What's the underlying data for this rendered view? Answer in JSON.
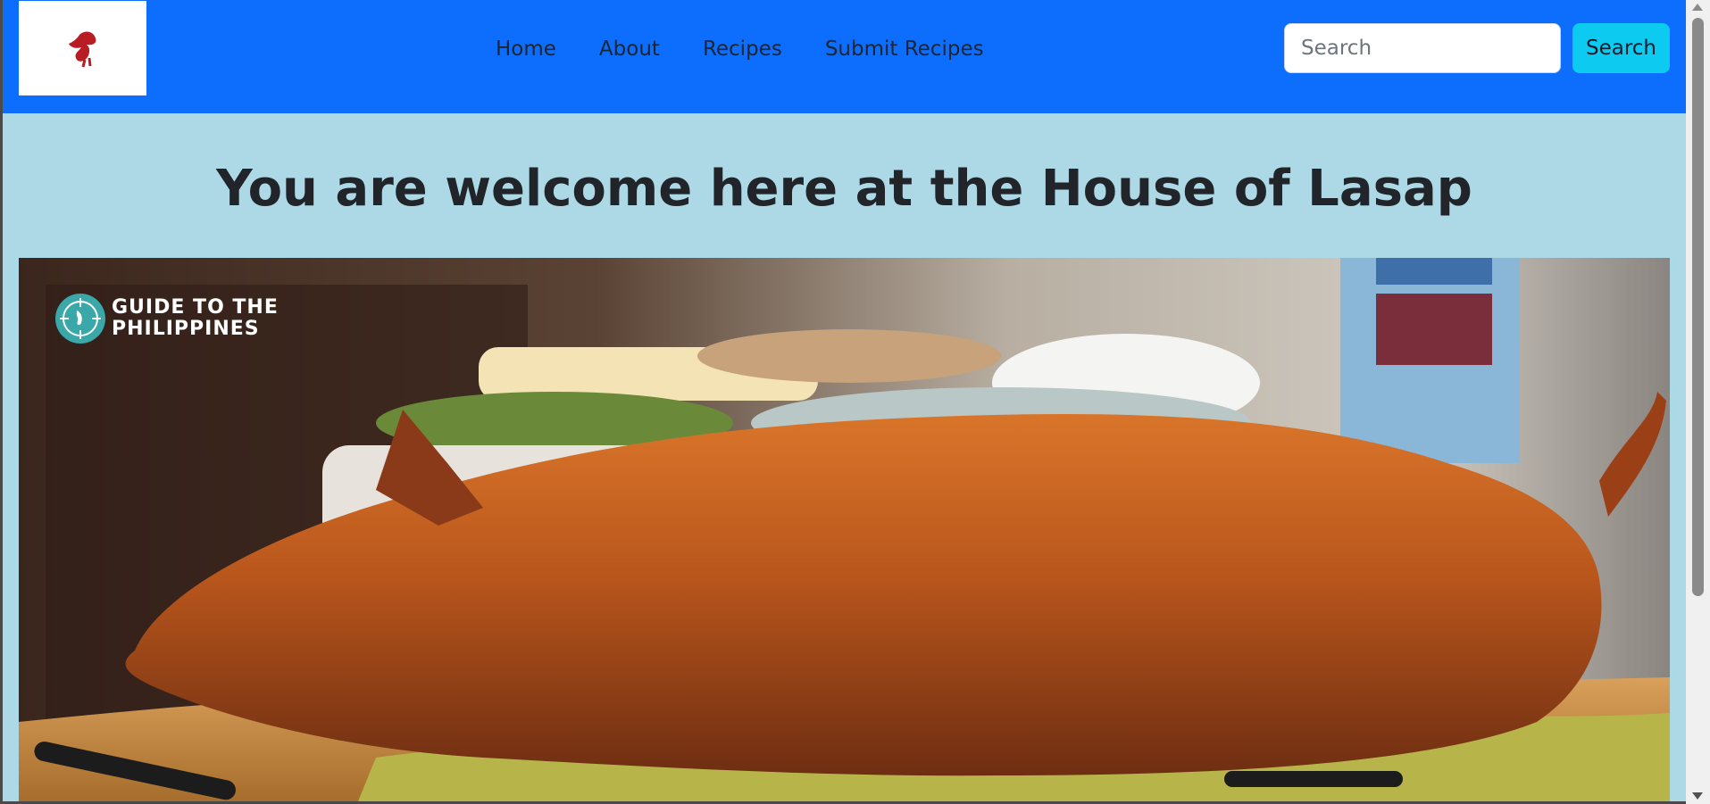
{
  "navbar": {
    "logo_icon": "rooster-icon",
    "links": [
      "Home",
      "About",
      "Recipes",
      "Submit Recipes"
    ],
    "search_placeholder": "Search",
    "search_button": "Search",
    "colors": {
      "navbar_bg": "#0d6efd",
      "search_button_bg": "#0dcaf0"
    }
  },
  "main": {
    "heading": "You are welcome here at the House of Lasap",
    "background": "#add8e6",
    "hero": {
      "subject": "lechon-roast-pig-photo",
      "watermark_line1": "GUIDE TO THE",
      "watermark_line2": "PHILIPPINES"
    }
  }
}
